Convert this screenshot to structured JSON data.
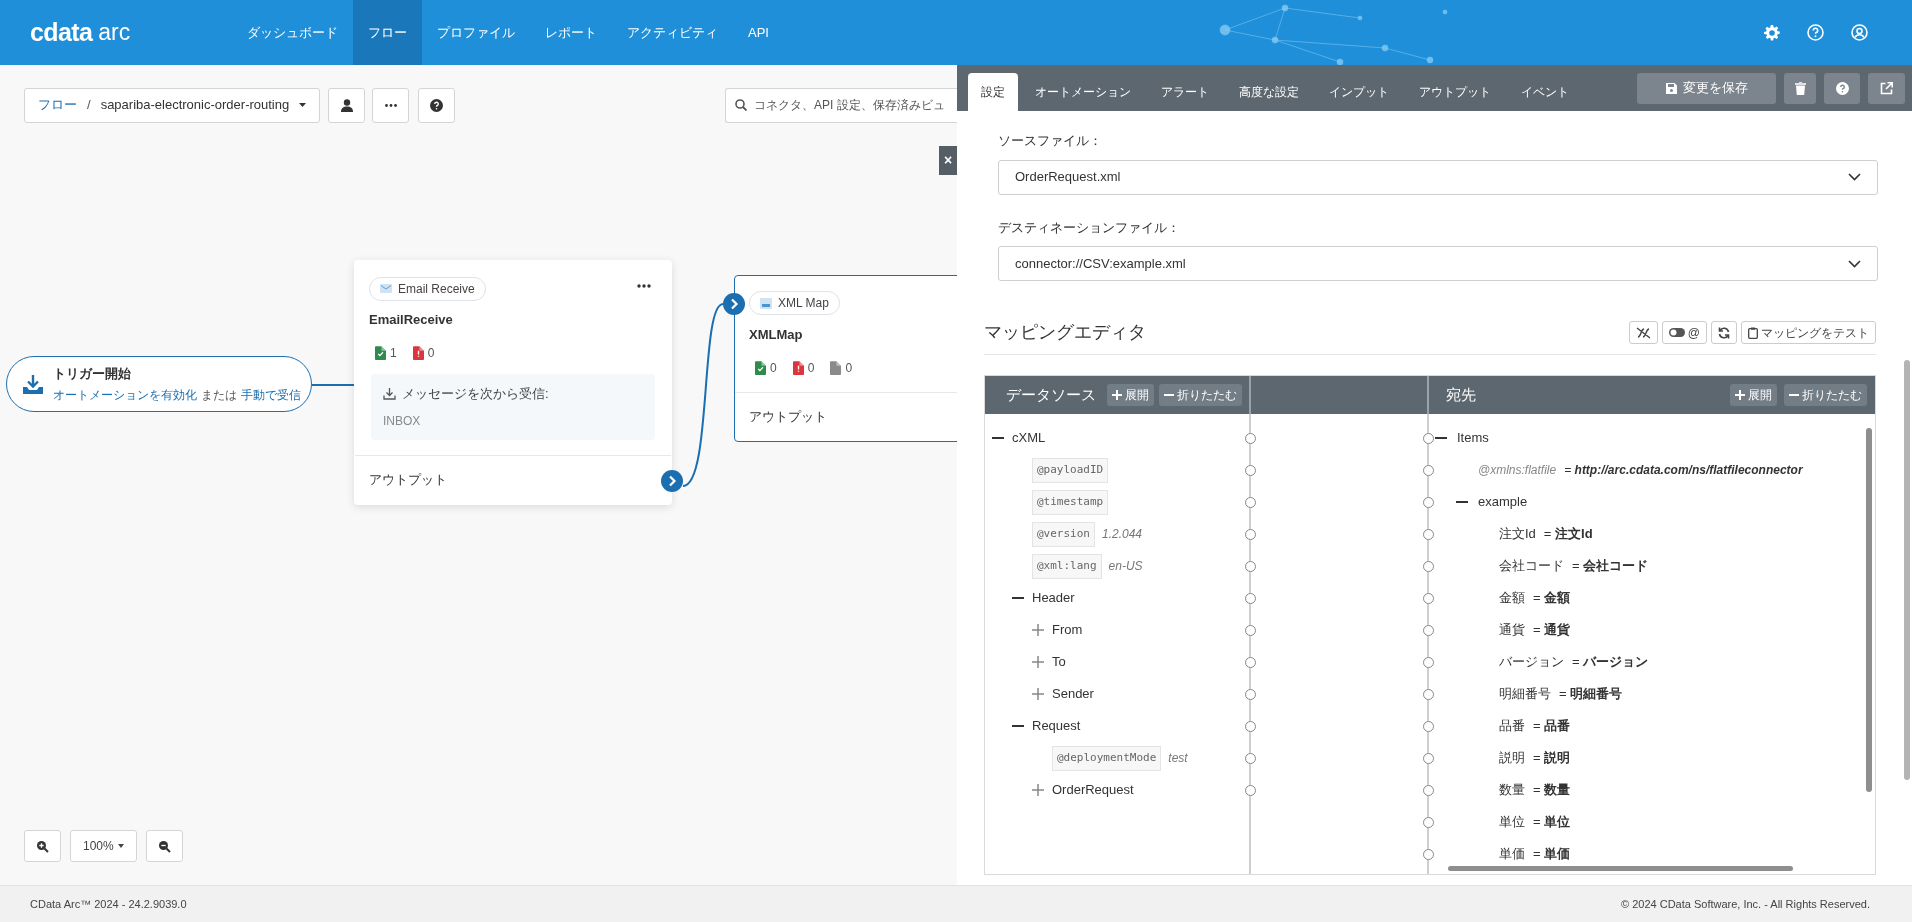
{
  "header": {
    "logo": "cdata",
    "logo_suffix": "arc",
    "nav": [
      {
        "label": "ダッシュボード",
        "selected": false
      },
      {
        "label": "フロー",
        "selected": true
      },
      {
        "label": "プロファイル",
        "selected": false
      },
      {
        "label": "レポート",
        "selected": false
      },
      {
        "label": "アクティビティ",
        "selected": false
      },
      {
        "label": "API",
        "selected": false
      }
    ]
  },
  "breadcrumb": {
    "root": "フロー",
    "separator": "/",
    "flow": "sapariba-electronic-order-routing"
  },
  "search": {
    "placeholder": "コネクタ、API 設定、保存済みビュ"
  },
  "trigger": {
    "title": "トリガー開始",
    "enable_link": "オートメーションを有効化",
    "conjunction": "または",
    "manual_link": "手動で受信"
  },
  "nodes": [
    {
      "badge": "Email Receive",
      "name": "EmailReceive",
      "counts": [
        {
          "kind": "success",
          "count": "1"
        },
        {
          "kind": "error",
          "count": "0"
        }
      ],
      "info_label": "メッセージを次から受信:",
      "info_value": "INBOX",
      "output": "アウトプット",
      "selected": false
    },
    {
      "badge": "XML Map",
      "name": "XMLMap",
      "counts": [
        {
          "kind": "success",
          "count": "0"
        },
        {
          "kind": "error",
          "count": "0"
        },
        {
          "kind": "pending",
          "count": "0"
        }
      ],
      "output": "アウトプット",
      "selected": true
    }
  ],
  "zoom": {
    "level": "100%"
  },
  "panel": {
    "close": "×",
    "save_button": "変更を保存",
    "tabs": [
      {
        "label": "設定",
        "selected": true
      },
      {
        "label": "オートメーション",
        "selected": false
      },
      {
        "label": "アラート",
        "selected": false
      },
      {
        "label": "高度な設定",
        "selected": false
      },
      {
        "label": "インプット",
        "selected": false
      },
      {
        "label": "アウトプット",
        "selected": false
      },
      {
        "label": "イベント",
        "selected": false
      }
    ],
    "source_file": {
      "label": "ソースファイル：",
      "value": "OrderRequest.xml"
    },
    "destination_file": {
      "label": "デスティネーションファイル：",
      "value": "connector://CSV:example.xml"
    }
  },
  "mapping": {
    "title": "マッピングエディタ",
    "toggle_label": "@",
    "test_button": "マッピングをテスト",
    "source": {
      "title": "データソース",
      "expand": "展開",
      "collapse": "折りたたむ",
      "tree": [
        {
          "kind": "element",
          "name": "cXML",
          "expanded": true,
          "children": [
            {
              "kind": "attribute",
              "name": "@payloadID"
            },
            {
              "kind": "attribute",
              "name": "@timestamp"
            },
            {
              "kind": "attribute",
              "name": "@version",
              "value": "1.2.044"
            },
            {
              "kind": "attribute",
              "name": "@xml:lang",
              "value": "en-US"
            },
            {
              "kind": "element",
              "name": "Header",
              "expanded": true,
              "children": [
                {
                  "kind": "element",
                  "name": "From",
                  "expanded": false
                },
                {
                  "kind": "element",
                  "name": "To",
                  "expanded": false
                },
                {
                  "kind": "element",
                  "name": "Sender",
                  "expanded": false
                }
              ]
            },
            {
              "kind": "element",
              "name": "Request",
              "expanded": true,
              "children": [
                {
                  "kind": "attribute",
                  "name": "@deploymentMode",
                  "value": "test"
                },
                {
                  "kind": "element",
                  "name": "OrderRequest",
                  "expanded": false
                }
              ]
            }
          ]
        }
      ]
    },
    "destination": {
      "title": "宛先",
      "expand": "展開",
      "collapse": "折りたたむ",
      "tree": [
        {
          "kind": "element",
          "name": "Items",
          "expanded": true,
          "children": [
            {
              "kind": "attribute",
              "name": "@xmlns:flatfile",
              "mapping": "= **http://arc.cdata.com/ns/flatfileconnector**"
            },
            {
              "kind": "element",
              "name": "example",
              "expanded": true,
              "children": [
                {
                  "kind": "field",
                  "name": "注文Id",
                  "mapping": "= **注文Id**"
                },
                {
                  "kind": "field",
                  "name": "会社コード",
                  "mapping": "= **会社コード**"
                },
                {
                  "kind": "field",
                  "name": "金額",
                  "mapping": "= **金額**"
                },
                {
                  "kind": "field",
                  "name": "通貨",
                  "mapping": "= **通貨**"
                },
                {
                  "kind": "field",
                  "name": "バージョン",
                  "mapping": "= **バージョン**"
                },
                {
                  "kind": "field",
                  "name": "明細番号",
                  "mapping": "= **明細番号**"
                },
                {
                  "kind": "field",
                  "name": "品番",
                  "mapping": "= **品番**"
                },
                {
                  "kind": "field",
                  "name": "説明",
                  "mapping": "= **説明**"
                },
                {
                  "kind": "field",
                  "name": "数量",
                  "mapping": "= **数量**"
                },
                {
                  "kind": "field",
                  "name": "単位",
                  "mapping": "= **単位**"
                },
                {
                  "kind": "field",
                  "name": "単価",
                  "mapping": "= **単価**"
                }
              ]
            }
          ]
        }
      ]
    }
  },
  "footer": {
    "version": "CData Arc™ 2024 - 24.2.9039.0",
    "copyright": "© 2024 CData Software, Inc. - All Rights Reserved."
  }
}
